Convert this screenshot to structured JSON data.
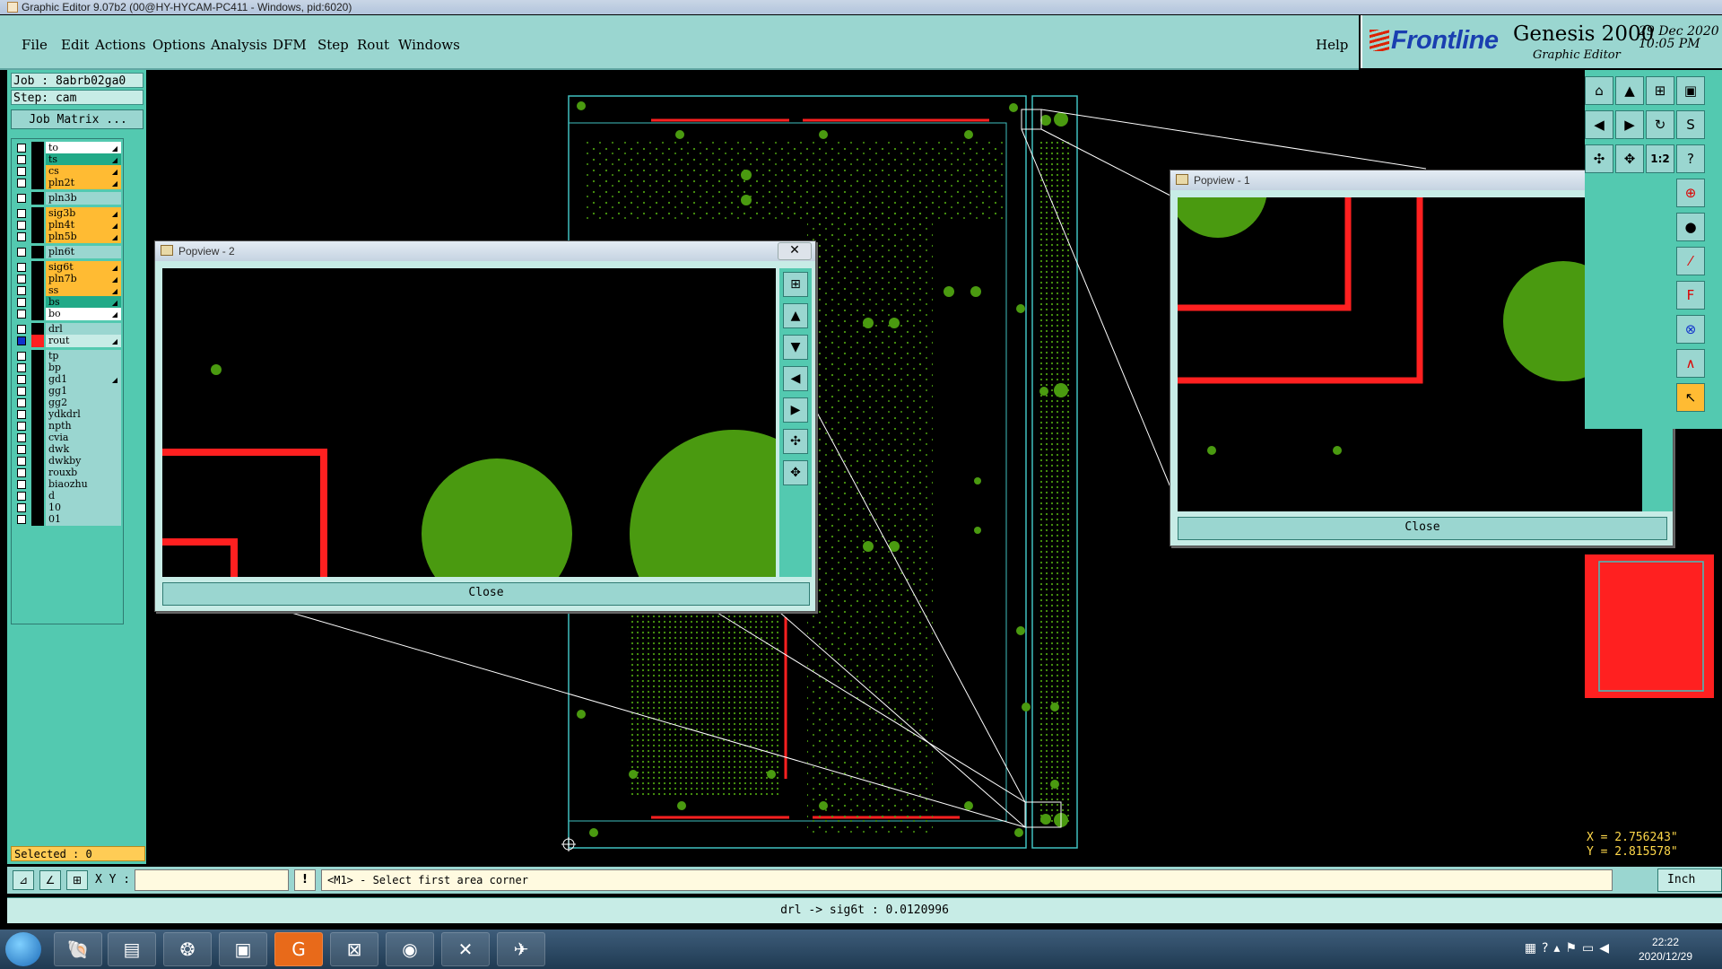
{
  "window": {
    "title": "Graphic Editor 9.07b2 (00@HY-HYCAM-PC411 - Windows, pid:6020)"
  },
  "menu": {
    "items": [
      "File",
      "Edit",
      "Actions",
      "Options",
      "Analysis",
      "DFM",
      "Step",
      "Rout",
      "Windows"
    ],
    "help": "Help"
  },
  "brand": {
    "logo": "Frontline",
    "product": "Genesis 2000",
    "subtitle": "Graphic Editor",
    "date": "29 Dec 2020",
    "time": "10:05 PM"
  },
  "job": {
    "job_label": "Job : 8abrb02ga0",
    "step_label": "Step: cam",
    "matrix_button": "Job Matrix ..."
  },
  "layers": [
    {
      "name": "to",
      "color": "#ffffff",
      "selected": false,
      "arrow": true
    },
    {
      "name": "ts",
      "color": "#22aa88",
      "selected": false,
      "arrow": true
    },
    {
      "name": "cs",
      "color": "#ffbb33",
      "selected": false,
      "arrow": true
    },
    {
      "name": "pln2t",
      "color": "#ffbb33",
      "selected": false,
      "arrow": true
    },
    {
      "name": "pln3b",
      "color": "#9ad6d0",
      "selected": false,
      "arrow": false
    },
    {
      "name": "sig3b",
      "color": "#ffbb33",
      "selected": false,
      "arrow": true
    },
    {
      "name": "pln4t",
      "color": "#ffbb33",
      "selected": false,
      "arrow": true
    },
    {
      "name": "pln5b",
      "color": "#ffbb33",
      "selected": false,
      "arrow": true
    },
    {
      "name": "pln6t",
      "color": "#9ad6d0",
      "selected": false,
      "arrow": false
    },
    {
      "name": "sig6t",
      "color": "#ffbb33",
      "selected": false,
      "arrow": true
    },
    {
      "name": "pln7b",
      "color": "#ffbb33",
      "selected": false,
      "arrow": true
    },
    {
      "name": "ss",
      "color": "#ffbb33",
      "selected": false,
      "arrow": true
    },
    {
      "name": "bs",
      "color": "#22aa88",
      "selected": false,
      "arrow": true
    },
    {
      "name": "bo",
      "color": "#ffffff",
      "selected": false,
      "arrow": true
    },
    {
      "name": "drl",
      "color": "#9ad6d0",
      "selected": false,
      "arrow": false
    },
    {
      "name": "rout",
      "color": "#c7ece6",
      "selected": true,
      "arrow": true
    },
    {
      "name": "tp",
      "color": "#9ad6d0",
      "selected": false,
      "arrow": false
    },
    {
      "name": "bp",
      "color": "#9ad6d0",
      "selected": false,
      "arrow": false
    },
    {
      "name": "gd1",
      "color": "#9ad6d0",
      "selected": false,
      "arrow": true
    },
    {
      "name": "gg1",
      "color": "#9ad6d0",
      "selected": false,
      "arrow": false
    },
    {
      "name": "gg2",
      "color": "#9ad6d0",
      "selected": false,
      "arrow": false
    },
    {
      "name": "ydkdrl",
      "color": "#9ad6d0",
      "selected": false,
      "arrow": false
    },
    {
      "name": "npth",
      "color": "#9ad6d0",
      "selected": false,
      "arrow": false
    },
    {
      "name": "cvia",
      "color": "#9ad6d0",
      "selected": false,
      "arrow": false
    },
    {
      "name": "dwk",
      "color": "#9ad6d0",
      "selected": false,
      "arrow": false
    },
    {
      "name": "dwkby",
      "color": "#9ad6d0",
      "selected": false,
      "arrow": false
    },
    {
      "name": "rouxb",
      "color": "#9ad6d0",
      "selected": false,
      "arrow": false
    },
    {
      "name": "biaozhu",
      "color": "#9ad6d0",
      "selected": false,
      "arrow": false
    },
    {
      "name": "d",
      "color": "#9ad6d0",
      "selected": false,
      "arrow": false
    },
    {
      "name": "10",
      "color": "#9ad6d0",
      "selected": false,
      "arrow": false
    },
    {
      "name": "01",
      "color": "#9ad6d0",
      "selected": false,
      "arrow": false
    }
  ],
  "selected_label": "Selected : 0",
  "popview2": {
    "title": "Popview - 2",
    "close_label": "Close"
  },
  "popview1": {
    "title": "Popview - 1",
    "close_label": "Close"
  },
  "coords": {
    "x": "X = 2.756243\"",
    "y": "Y = 2.815578\""
  },
  "cmd": {
    "xy_label": "X Y :",
    "xy_value": "",
    "bang": "!",
    "prompt": "<M1> - Select first area corner",
    "units": "Inch"
  },
  "status": "drl -> sig6t : 0.0120996",
  "clock": {
    "time": "22:22",
    "date": "2020/12/29"
  },
  "colors": {
    "panel": "#53c9b0",
    "panel_light": "#9ad6d0",
    "copper": "#4a9a10",
    "rout": "#ff2020",
    "outline": "#40c0c0"
  }
}
